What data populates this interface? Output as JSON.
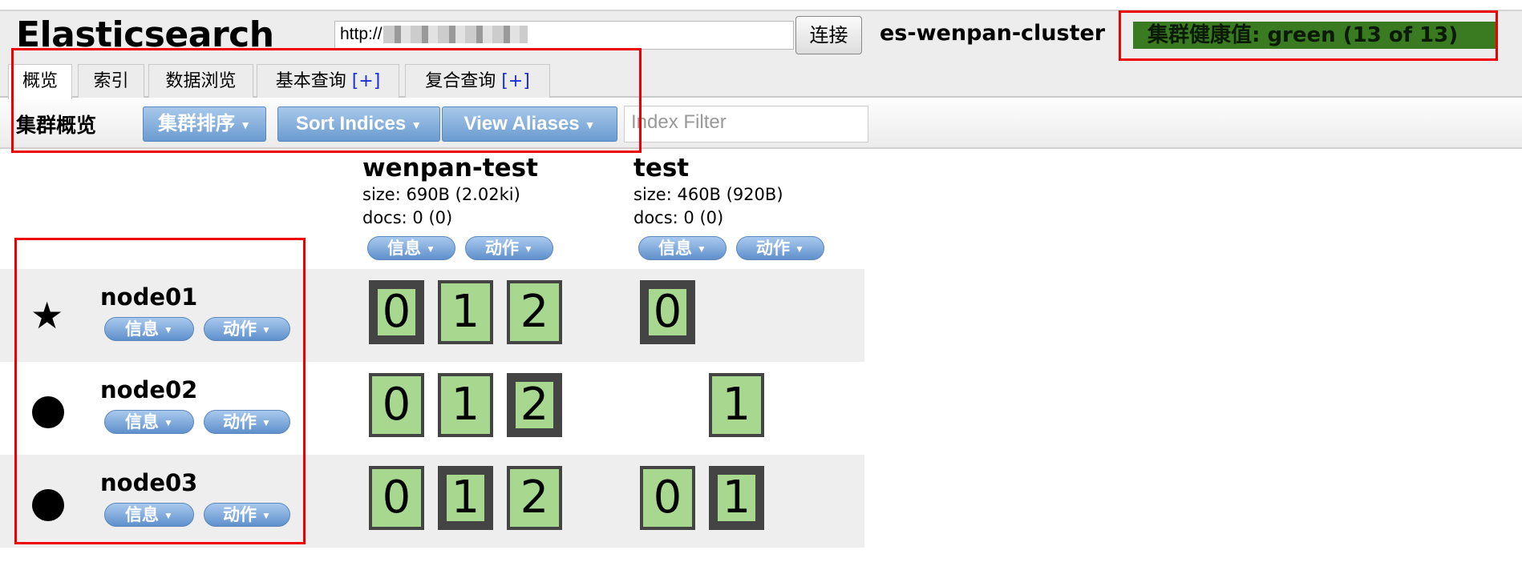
{
  "header": {
    "title": "Elasticsearch",
    "url": "http://[redacted]9200/",
    "connect_label": "连接",
    "cluster_name": "es-wenpan-cluster",
    "health": "集群健康值: green (13 of 13)",
    "health_color": "#3a7a20"
  },
  "tabs": [
    {
      "label": "概览",
      "active": true
    },
    {
      "label": "索引"
    },
    {
      "label": "数据浏览"
    },
    {
      "label": "基本查询",
      "plus": "[+]"
    },
    {
      "label": "复合查询",
      "plus": "[+]"
    }
  ],
  "toolbar": {
    "title": "集群概览",
    "sort_cluster": "集群排序",
    "sort_indices": "Sort Indices",
    "view_aliases": "View Aliases",
    "filter_placeholder": "Index Filter"
  },
  "pill": {
    "info": "信息",
    "action": "动作"
  },
  "indices": [
    {
      "name": "wenpan-test",
      "size": "size: 690B (2.02ki)",
      "docs": "docs: 0 (0)"
    },
    {
      "name": "test",
      "size": "size: 460B (920B)",
      "docs": "docs: 0 (0)"
    }
  ],
  "nodes": [
    {
      "name": "node01",
      "icon": "star-icon",
      "master": true,
      "shards": {
        "wenpan-test": [
          {
            "n": "0",
            "primary": true
          },
          {
            "n": "1"
          },
          {
            "n": "2"
          }
        ],
        "test": [
          {
            "n": "0",
            "primary": true
          }
        ]
      }
    },
    {
      "name": "node02",
      "icon": "circle-icon",
      "shards": {
        "wenpan-test": [
          {
            "n": "0"
          },
          {
            "n": "1"
          },
          {
            "n": "2",
            "primary": true
          }
        ],
        "test": [
          {
            "n": "1"
          }
        ]
      }
    },
    {
      "name": "node03",
      "icon": "circle-icon",
      "shards": {
        "wenpan-test": [
          {
            "n": "0"
          },
          {
            "n": "1",
            "primary": true
          },
          {
            "n": "2"
          }
        ],
        "test": [
          {
            "n": "0"
          },
          {
            "n": "1",
            "primary": true
          }
        ]
      }
    }
  ],
  "shard_color": "#a8d88f"
}
